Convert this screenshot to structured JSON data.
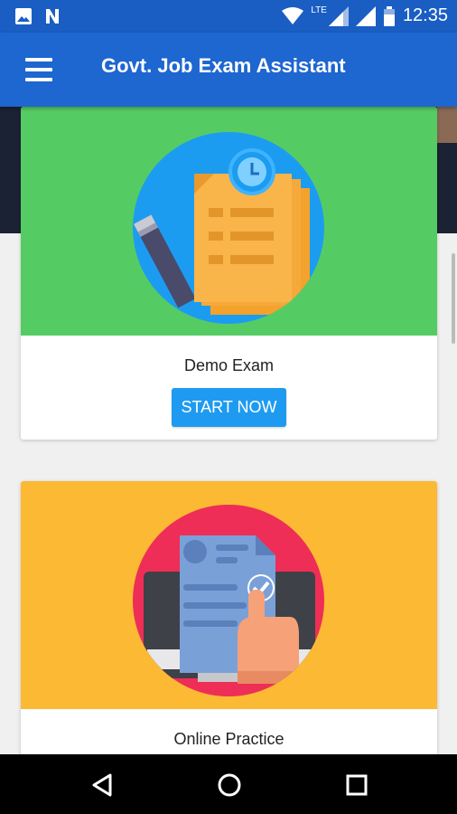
{
  "status_bar": {
    "time": "12:35",
    "network": "LTE",
    "icons": [
      "image-icon",
      "n-notification-icon",
      "wifi-icon",
      "signal-icon",
      "battery-icon"
    ]
  },
  "app_bar": {
    "title": "Govt. Job Exam Assistant",
    "menu_icon": "hamburger-menu-icon"
  },
  "cards": [
    {
      "title": "Demo Exam",
      "button_label": "START NOW",
      "image_bg": "#55cc63",
      "image_icon": "exam-papers-stopwatch-icon"
    },
    {
      "title": "Online Practice",
      "image_bg": "#fcb934",
      "image_icon": "monitor-document-check-icon"
    }
  ],
  "nav_bar": {
    "icons": [
      "back-icon",
      "home-icon",
      "recents-icon"
    ]
  },
  "colors": {
    "primary": "#1e66d0",
    "accent": "#1e9bf0"
  }
}
